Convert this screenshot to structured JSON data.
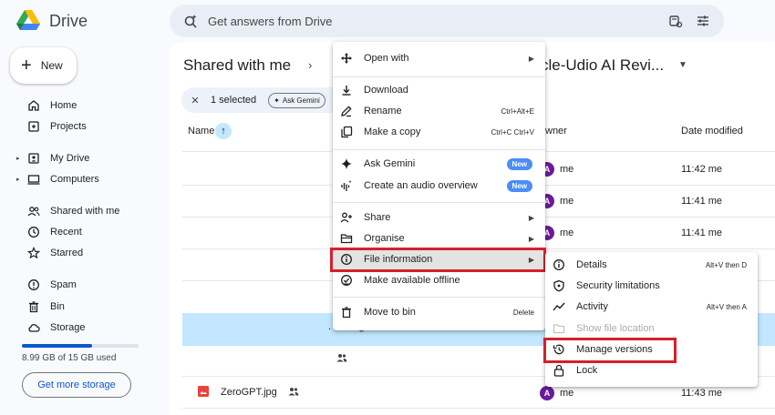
{
  "app": {
    "name": "Drive"
  },
  "search": {
    "placeholder": "Get answers from Drive"
  },
  "sidebar": {
    "new_label": "New",
    "items": [
      {
        "label": "Home"
      },
      {
        "label": "Projects"
      },
      {
        "label": "My Drive"
      },
      {
        "label": "Computers"
      },
      {
        "label": "Shared with me"
      },
      {
        "label": "Recent"
      },
      {
        "label": "Starred"
      },
      {
        "label": "Spam"
      },
      {
        "label": "Bin"
      },
      {
        "label": "Storage"
      }
    ],
    "storage_used_fraction": 0.6,
    "storage_text": "8.99 GB of 15 GB used",
    "storage_button": "Get more storage"
  },
  "breadcrumb": {
    "root": "Shared with me",
    "separator": "›",
    "file": "cle-Udio AI Revi..."
  },
  "selection": {
    "count_label": "1 selected",
    "ask_gemini": "Ask Gemini"
  },
  "columns": {
    "name": "Name",
    "owner": "wner",
    "date_modified": "Date modified"
  },
  "rows": [
    {
      "owner": "me",
      "owner_initial": "A",
      "modified": "11:42 me"
    },
    {
      "owner": "me",
      "owner_initial": "A",
      "modified": "11:41 me"
    },
    {
      "owner": "me",
      "owner_initial": "A",
      "modified": "11:41 me"
    },
    {
      "name": "ZeroGPT.jpg",
      "owner": "me",
      "owner_initial": "A",
      "modified": "11:43 me"
    }
  ],
  "row_fragment": ". Pricing & Alternatives.docx",
  "context_menu": {
    "open_with": "Open with",
    "download": "Download",
    "rename": "Rename",
    "rename_shortcut": "Ctrl+Alt+E",
    "make_copy": "Make a copy",
    "make_copy_shortcut": "Ctrl+C Ctrl+V",
    "ask_gemini": "Ask Gemini",
    "audio_overview": "Create an audio overview",
    "new_badge": "New",
    "share": "Share",
    "organise": "Organise",
    "file_information": "File information",
    "offline": "Make available offline",
    "move_to_bin": "Move to bin",
    "delete_shortcut": "Delete"
  },
  "submenu": {
    "details": "Details",
    "details_shortcut": "Alt+V then D",
    "security": "Security limitations",
    "activity": "Activity",
    "activity_shortcut": "Alt+V then A",
    "show_location": "Show file location",
    "manage_versions": "Manage versions",
    "lock": "Lock"
  }
}
